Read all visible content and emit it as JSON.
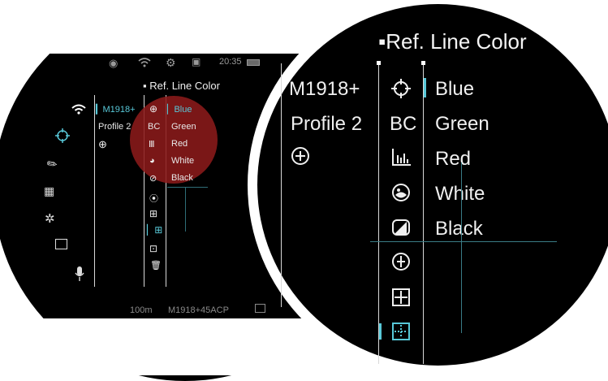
{
  "status_bar": {
    "time": "20:35"
  },
  "left_panel": {
    "menu_title": "Ref. Line Color",
    "profiles": [
      "M1918+",
      "Profile 2"
    ],
    "codes": [
      "BC"
    ],
    "colors": [
      "Blue",
      "Green",
      "Red",
      "White",
      "Black"
    ]
  },
  "bottom_bar": {
    "distance": "100m",
    "profile_name": "M1918+45ACP"
  },
  "zoom_panel": {
    "menu_title": "Ref. Line Color",
    "profiles": [
      "M1918+",
      "Profile 2"
    ],
    "codes": [
      "BC"
    ],
    "colors": [
      "Blue",
      "Green",
      "Red",
      "White",
      "Black"
    ]
  },
  "accent_color": "#58c8d8",
  "highlight_color": "#8b1a1a",
  "icons": [
    "eye-icon",
    "wifi-icon",
    "gear-icon",
    "display-icon",
    "battery-icon",
    "crosshair-icon",
    "ballistic-icon",
    "media-icon",
    "aperture-icon",
    "frame-icon",
    "mic-icon",
    "add-icon",
    "color-picker-icon",
    "contrast-icon",
    "ref-line-icon",
    "grid-icon",
    "delete-icon"
  ]
}
